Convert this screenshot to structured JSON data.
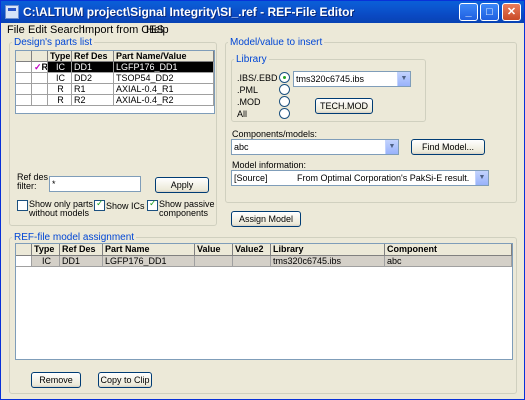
{
  "window": {
    "title": "C:\\ALTIUM project\\Signal Integrity\\SI_.ref - REF-File Editor",
    "minimize": "_",
    "maximize": "□",
    "close": "✕"
  },
  "menu": [
    "File",
    "Edit",
    "Search",
    "Import from CES",
    "Help"
  ],
  "parts_list": {
    "legend": "Design's parts list",
    "columns": [
      "Type",
      "Ref Des",
      "Part Name/Value"
    ],
    "rows": [
      {
        "flag": "R",
        "type": "IC",
        "ref": "DD1",
        "part": "LGFP176_DD1",
        "selected": true
      },
      {
        "flag": "",
        "type": "IC",
        "ref": "DD2",
        "part": "TSOP54_DD2",
        "selected": false
      },
      {
        "flag": "",
        "type": "R",
        "ref": "R1",
        "part": "AXIAL-0.4_R1",
        "selected": false
      },
      {
        "flag": "",
        "type": "R",
        "ref": "R2",
        "part": "AXIAL-0.4_R2",
        "selected": false
      }
    ],
    "filter_label_1": "Ref des",
    "filter_label_2": "filter:",
    "filter_value": "*",
    "apply_label": "Apply",
    "opt_only_parts_1": "Show only parts",
    "opt_only_parts_2": "without models",
    "opt_show_ics": "Show ICs",
    "opt_show_passive_1": "Show passive",
    "opt_show_passive_2": "components"
  },
  "model": {
    "legend": "Model/value to insert",
    "library_legend": "Library",
    "radio_ibs": ".IBS/.EBD",
    "radio_pml": ".PML",
    "radio_mod": ".MOD",
    "radio_all": "All",
    "library_file": "tms320c6745.ibs",
    "tech_mod_label": "TECH.MOD",
    "components_label": "Components/models:",
    "components_value": "abc",
    "find_model_label": "Find Model...",
    "info_label": "Model information:",
    "info_key": "[Source]",
    "info_value": "From Optimal Corporation's PakSi-E result."
  },
  "assign_label": "Assign Model",
  "assignment": {
    "legend": "REF-file model assignment",
    "columns": [
      "Type",
      "Ref Des",
      "Part Name",
      "Value",
      "Value2",
      "Library",
      "Component"
    ],
    "rows": [
      {
        "type": "IC",
        "ref": "DD1",
        "part": "LGFP176_DD1",
        "value": "",
        "value2": "",
        "library": "tms320c6745.ibs",
        "component": "abc"
      }
    ]
  },
  "remove_label": "Remove",
  "copy_label": "Copy to Clip",
  "colors": {
    "title_bar": "#0a5fd8",
    "selection": "#000000",
    "legend": "#0046d5"
  }
}
